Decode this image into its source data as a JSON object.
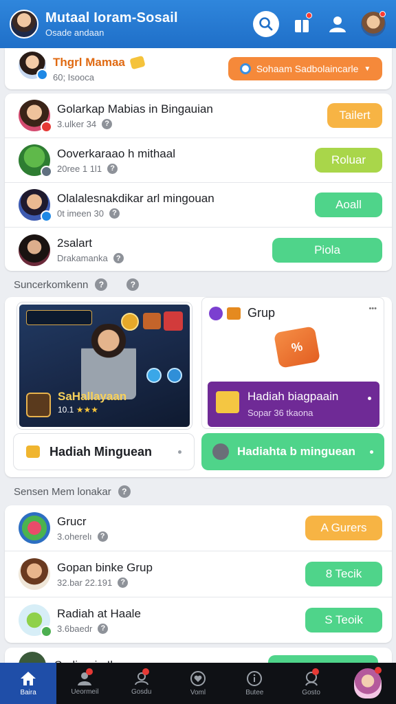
{
  "header": {
    "title": "Mutaal Ioram-Sosail",
    "subtitle": "Osade andaan",
    "icons": [
      "search-icon",
      "gift-icon",
      "user-icon",
      "profile-avatar"
    ]
  },
  "top_row": {
    "name": "Thgrl Mamaa",
    "meta": "60; Isooca",
    "button": "Sohaam Sadbolaincarle"
  },
  "friends": [
    {
      "name": "Golarkap Mabias in Bingauian",
      "meta": "3.ulker 34",
      "button": "Tailert",
      "color": "orange"
    },
    {
      "name": "Ooverkaraao h mithaal",
      "meta": "20ree 1 1l1",
      "button": "Roluar",
      "color": "lime"
    },
    {
      "name": "Olalalesnakdikar arl mingouan",
      "meta": "0t imeen 30",
      "button": "Aoall",
      "color": "green"
    },
    {
      "name": "2salart",
      "meta": "Drakamanka",
      "button": "Piola",
      "color": "green"
    }
  ],
  "section1": {
    "label": "Suncerkomkenn"
  },
  "game_card": {
    "title": "SaHallayaan",
    "sub": "10.1",
    "stars": "★★★"
  },
  "grup_card": {
    "title": "Grup",
    "corner": "•••"
  },
  "promo": {
    "title": "Hadiah biagpaain",
    "sub": "Sopar 36 tkaona"
  },
  "weekly_left": {
    "label": "Hadiah Minguean"
  },
  "weekly_right": {
    "label": "Hadiahta b minguean"
  },
  "section2": {
    "label": "Sensen Mem lonakar"
  },
  "groups": [
    {
      "name": "Grucr",
      "meta": "3.oherelı",
      "button": "A Gurers",
      "color": "orange"
    },
    {
      "name": "Gopan binke Grup",
      "meta": "32.bar 22.191",
      "button": "8 Tecik",
      "color": "green"
    },
    {
      "name": "Radiah at Haale",
      "meta": "3.6baedr",
      "button": "S Teoik",
      "color": "green"
    }
  ],
  "partial_row": {
    "name": "Sadiorain Ilaan"
  },
  "nav": [
    {
      "label": "Baira",
      "icon": "home-icon",
      "active": true
    },
    {
      "label": "Ueormeil",
      "icon": "friends-icon",
      "badge": true
    },
    {
      "label": "Gosdu",
      "icon": "group-icon",
      "badge": true
    },
    {
      "label": "Voml",
      "icon": "heart-icon"
    },
    {
      "label": "Butee",
      "icon": "info-icon"
    },
    {
      "label": "Gosto",
      "icon": "chat-icon",
      "badge": true
    },
    {
      "label": "",
      "icon": "profile-avatar"
    }
  ],
  "colors": {
    "header": "#2f86dc",
    "green": "#4fd48a",
    "orange": "#f7b444",
    "lime": "#a9d64a",
    "purple": "#6f2a96",
    "nav_active": "#1f4ea8"
  }
}
